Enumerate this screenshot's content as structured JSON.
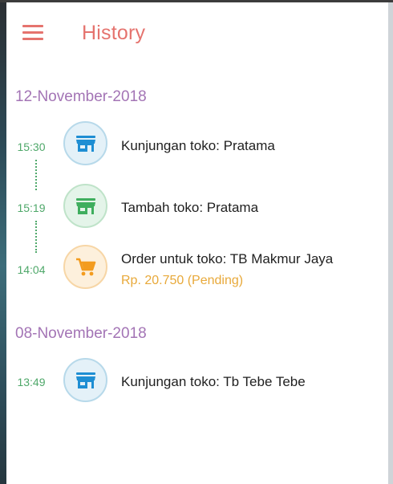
{
  "header": {
    "title": "History",
    "menu_icon": "hamburger-menu-icon"
  },
  "colors": {
    "accent": "#e5736e",
    "date": "#a374b5",
    "time": "#4fa86a",
    "pending": "#e8a93a"
  },
  "groups": [
    {
      "date": "12-November-2018",
      "entries": [
        {
          "time": "15:30",
          "icon": "store-icon",
          "color": "blue",
          "title": "Kunjungan toko: Pratama"
        },
        {
          "time": "15:19",
          "icon": "store-icon",
          "color": "green",
          "title": "Tambah toko: Pratama"
        },
        {
          "time": "14:04",
          "icon": "cart-icon",
          "color": "orange",
          "title": "Order untuk toko: TB Makmur Jaya",
          "subtitle": "Rp. 20.750 (Pending)"
        }
      ]
    },
    {
      "date": "08-November-2018",
      "entries": [
        {
          "time": "13:49",
          "icon": "store-icon",
          "color": "blue",
          "title": "Kunjungan toko: Tb Tebe Tebe"
        }
      ]
    }
  ]
}
